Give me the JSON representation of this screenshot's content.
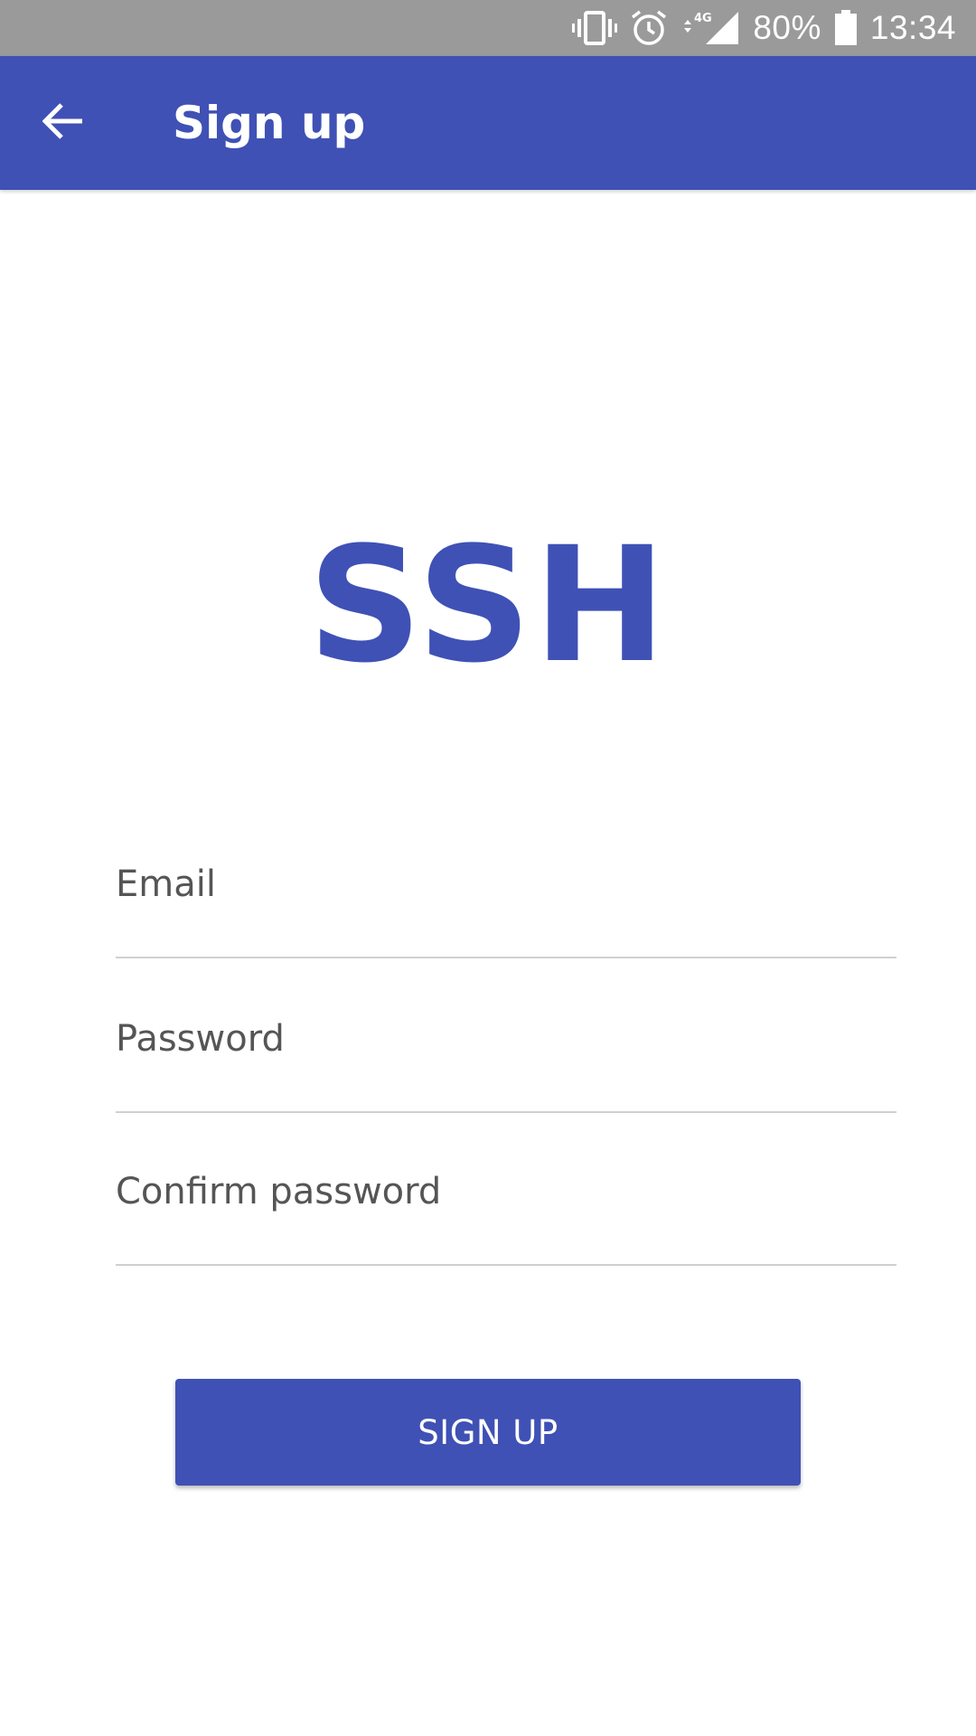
{
  "status_bar": {
    "battery": "80%",
    "time": "13:34",
    "network": "4G",
    "icons": [
      "vibrate-icon",
      "alarm-icon",
      "signal-icon",
      "battery-icon"
    ]
  },
  "app_bar": {
    "title": "Sign up",
    "back_icon": "arrow-back-icon",
    "color": "#3f51b5"
  },
  "logo": {
    "text": "SSH",
    "color": "#3f51b5"
  },
  "form": {
    "email_placeholder": "Email",
    "email_value": "",
    "password_placeholder": "Password",
    "password_value": "",
    "confirm_placeholder": "Confirm password",
    "confirm_value": "",
    "submit_label": "SIGN UP"
  }
}
